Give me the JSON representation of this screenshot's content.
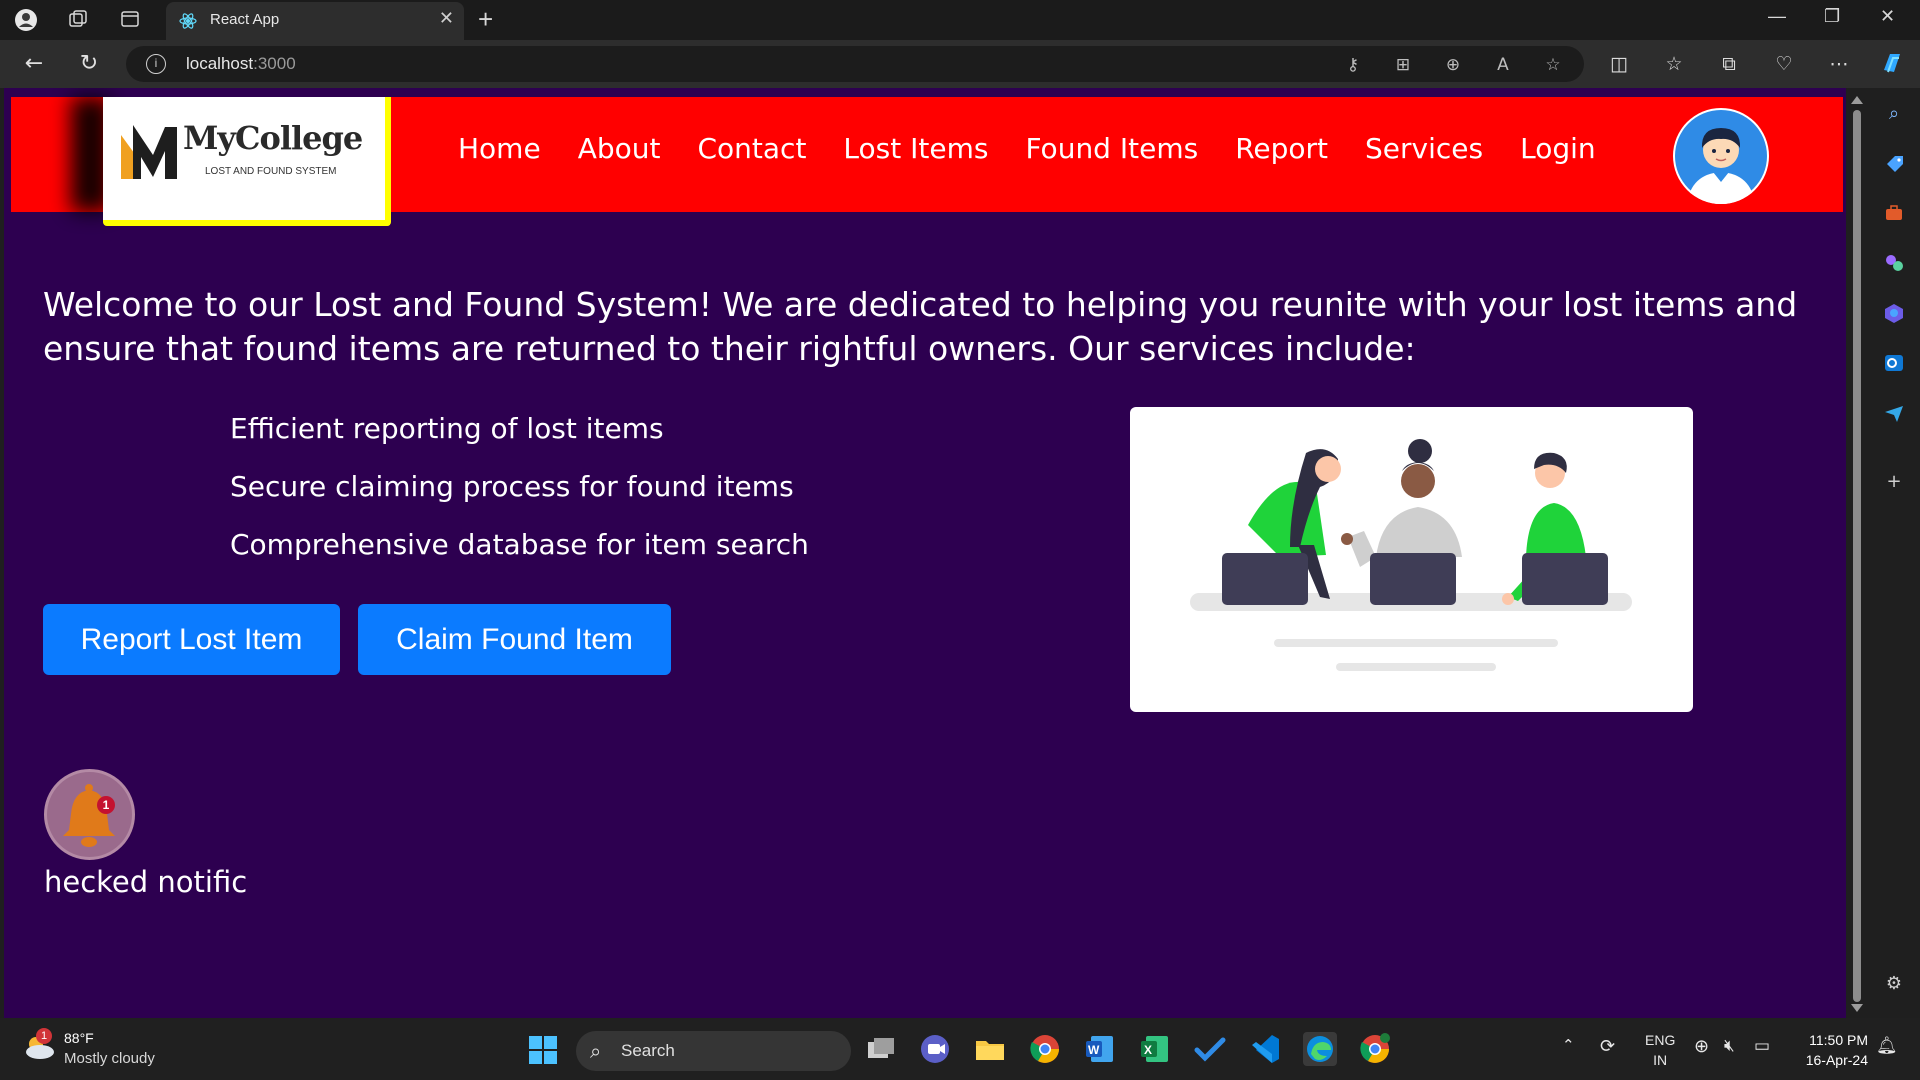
{
  "browser": {
    "tab_title": "React App",
    "url_host": "localhost",
    "url_port": ":3000"
  },
  "navbar": {
    "logo_name": "MyCollege",
    "logo_subtitle": "LOST AND FOUND SYSTEM",
    "links": [
      "Home",
      "About",
      "Contact",
      "Lost Items",
      "Found Items",
      "Report",
      "Services",
      "Login"
    ],
    "bg_color": "#ff0000"
  },
  "main": {
    "intro": "Welcome to our Lost and Found System! We are dedicated to helping you reunite with your lost items and ensure that found items are returned to their rightful owners. Our services include:",
    "features": [
      "Efficient reporting of lost items",
      "Secure claiming process for found items",
      "Comprehensive database for item search"
    ],
    "report_button": "Report Lost Item",
    "claim_button": "Claim Found Item",
    "bg_color": "#2d0050",
    "button_color": "#0b7bff"
  },
  "notification": {
    "badge_count": "1",
    "text": "hecked notific"
  },
  "taskbar": {
    "weather_badge": "1",
    "weather_temp": "88°F",
    "weather_desc": "Mostly cloudy",
    "search_label": "Search",
    "lang_top": "ENG",
    "lang_bottom": "IN",
    "time": "11:50 PM",
    "date": "16-Apr-24"
  }
}
